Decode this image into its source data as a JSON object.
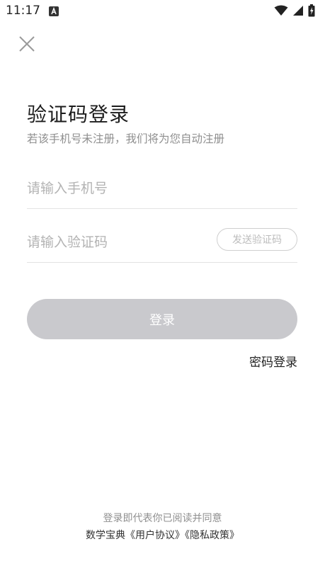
{
  "status_bar": {
    "time": "11:17",
    "icons": [
      "notification-a-icon",
      "wifi-icon",
      "signal-icon",
      "battery-icon"
    ]
  },
  "header": {
    "close_icon": "close-icon"
  },
  "main": {
    "title": "验证码登录",
    "subtitle": "若该手机号未注册，我们将为您自动注册",
    "phone_placeholder": "请输入手机号",
    "code_placeholder": "请输入验证码",
    "send_code_label": "发送验证码",
    "login_label": "登录",
    "password_login_label": "密码登录"
  },
  "footer": {
    "agree_text": "登录即代表你已阅读并同意",
    "app_name": "数学宝典",
    "user_agreement": "《用户协议》",
    "privacy_policy": "《隐私政策》"
  },
  "colors": {
    "login_button_bg": "#c9c9cd",
    "placeholder": "#b3b3b3",
    "divider": "#e3e3e3"
  }
}
